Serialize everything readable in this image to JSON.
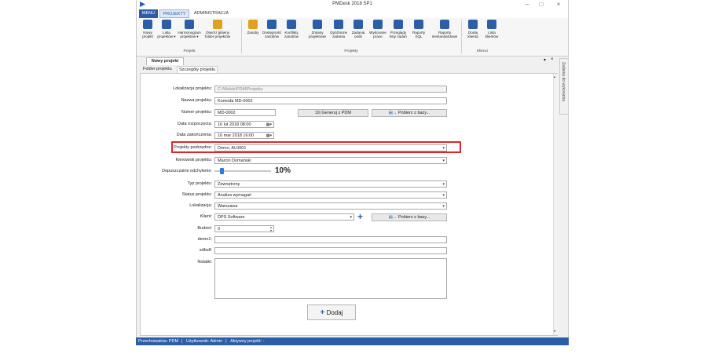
{
  "window": {
    "title": "PMDesk 2018 SP1"
  },
  "menu_tabs": [
    "MENU",
    "PROJEKTY",
    "ADMINISTRACJA"
  ],
  "ribbon": {
    "buttons": [
      {
        "label": "Nowy\nprojekt",
        "icon": "new-project-icon"
      },
      {
        "label": "Lista\nprojektów ▾",
        "icon": "list-icon"
      },
      {
        "label": "Harmonogram\nprojektów ▾",
        "icon": "gantt-icon"
      },
      {
        "label": "Otwórz główny\nfolder projektów",
        "icon": "folder-icon"
      },
      {
        "label": "Zasoby",
        "icon": "resources-icon"
      },
      {
        "label": "Dostępność\nzasobów",
        "icon": "availability-icon"
      },
      {
        "label": "Konflikty\nzasobów",
        "icon": "conflict-icon"
      },
      {
        "label": "Zmiany\nprojektowe",
        "icon": "changes-icon"
      },
      {
        "label": "Opóźnione\nzadania",
        "icon": "delayed-icon"
      },
      {
        "label": "Zadania\nosób",
        "icon": "tasks-icon"
      },
      {
        "label": "Wykonane\nprace",
        "icon": "done-icon"
      },
      {
        "label": "Przeglądy\nlisty zadań",
        "icon": "review-icon"
      },
      {
        "label": "Raporty\nSQL",
        "icon": "sql-report-icon"
      },
      {
        "label": "Raporty\nniestandardowe",
        "icon": "custom-report-icon"
      },
      {
        "label": "Dodaj\nklienta",
        "icon": "add-client-icon"
      },
      {
        "label": "Lista\nklientów",
        "icon": "clients-icon"
      }
    ],
    "groups": [
      "Projekt",
      "Projekty",
      "Klienci"
    ]
  },
  "doc_tab": "Nowy projekt",
  "sub_tabs": [
    "Folder projektu",
    "Szczegóły projektu"
  ],
  "dock_label": "Zadania do wykonania",
  "form": {
    "lokalizacja": {
      "label": "Lokalizacja projektu:",
      "value": "C:\\Widok\\PDM\\Projekty"
    },
    "nazwa": {
      "label": "Nazwa projektu:",
      "value": "Komoda MD-0002"
    },
    "numer": {
      "label": "Numer projektu:",
      "value": "MD-0002"
    },
    "generuj": "Generuj z PDM",
    "pobierz": "Pobierz z bazy...",
    "data_rozp": {
      "label": "Data rozpoczęcia:",
      "value": "16  lut  2018  08:00"
    },
    "data_zak": {
      "label": "Data zakończenia:",
      "value": "16  mar  2018  16:00"
    },
    "podrzedne": {
      "label": "Projekty podrzędne:",
      "value": "Demo, AL0001"
    },
    "kierownik": {
      "label": "Kierownik projektu:",
      "value": "Marcin Domański"
    },
    "odchylenie": {
      "label": "Dopuszczalne odchylenie:",
      "value": "10%",
      "level": 0.1
    },
    "typ": {
      "label": "Typ projektu:",
      "value": "Zewnętrzny"
    },
    "status": {
      "label": "Status projektu:",
      "value": "Analiza wymagań"
    },
    "lokalizacja2": {
      "label": "Lokalizacja:",
      "value": "Warszawa"
    },
    "klient": {
      "label": "Klient:",
      "value": "DPS Software"
    },
    "pobierz2": "Pobierz z bazy...",
    "budzet": {
      "label": "Budżet:",
      "value": "0"
    },
    "demo1": {
      "label": "demo1:",
      "value": ""
    },
    "sdfsdf": {
      "label": "sdfsdf:",
      "value": ""
    },
    "notatki": {
      "label": "Notatki:",
      "value": ""
    },
    "dodaj": "Dodaj"
  },
  "status_bar": {
    "przechowalnia": "Przechowalnia: PDM",
    "uzytkownik": "Użytkownik: Admin",
    "aktywny": "Aktywny projekt: -"
  },
  "colors": {
    "accent": "#2c5ea8",
    "highlight": "#e2252b"
  }
}
